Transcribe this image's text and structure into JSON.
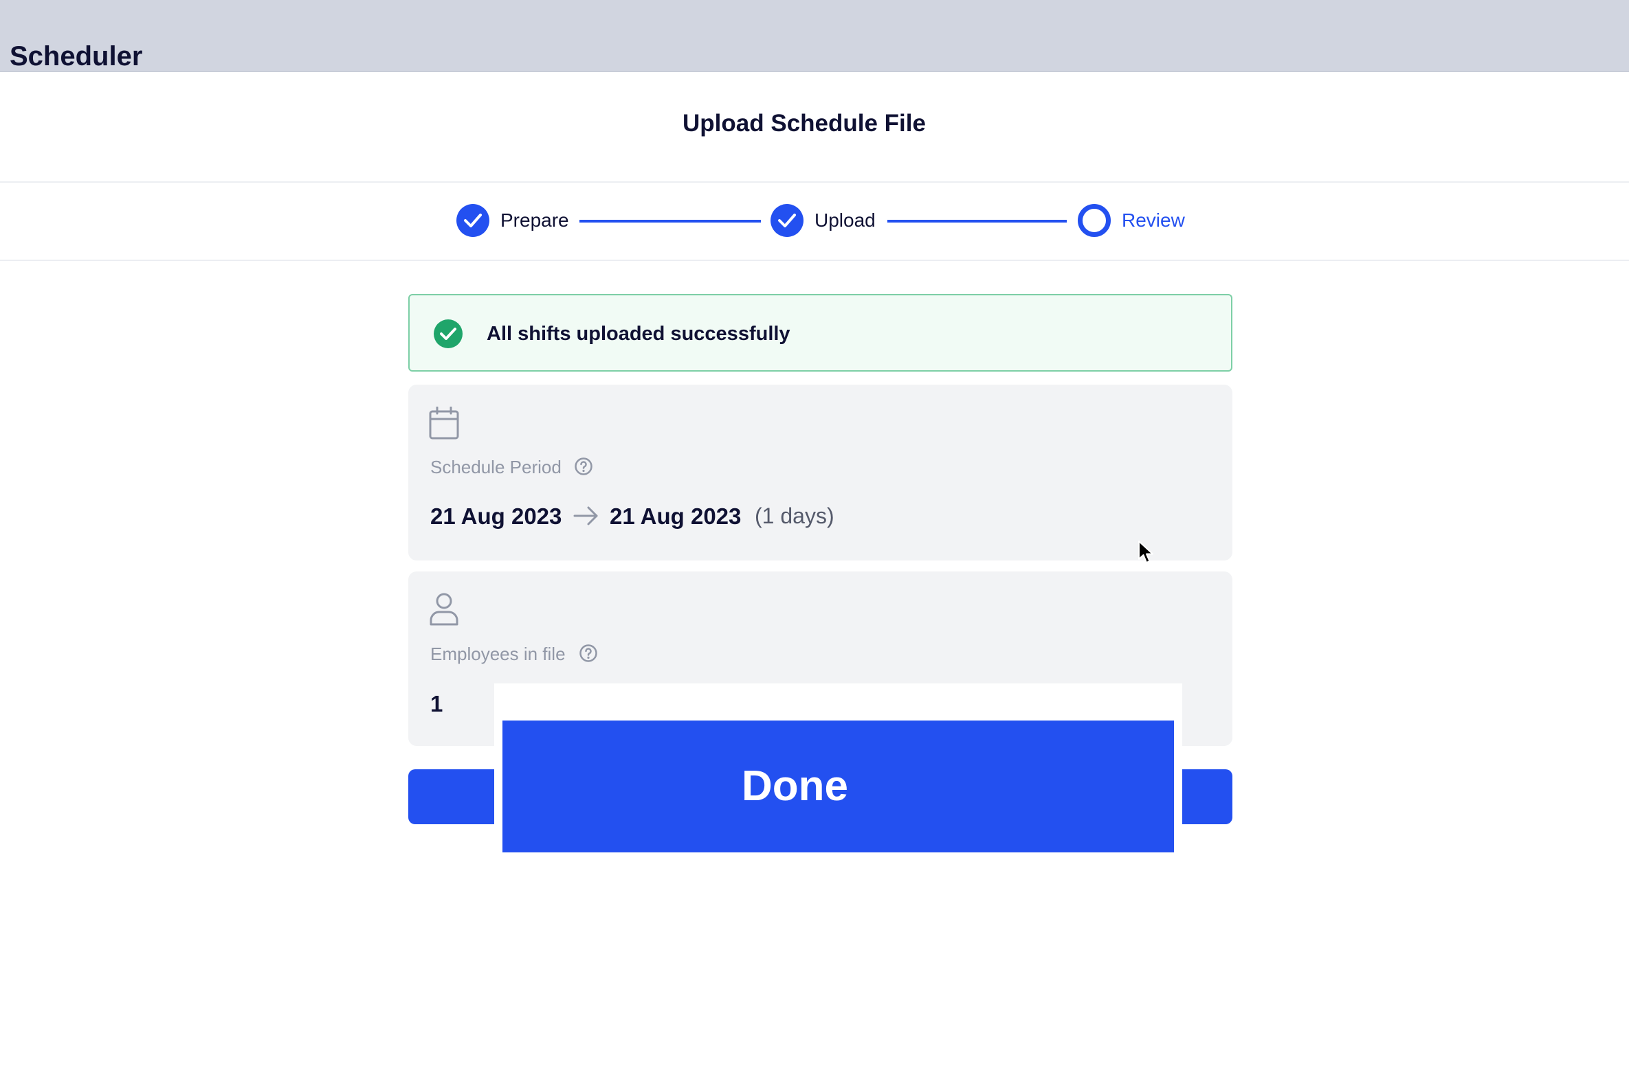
{
  "app": {
    "title": "Scheduler"
  },
  "modal": {
    "title": "Upload Schedule File"
  },
  "stepper": {
    "steps": [
      {
        "label": "Prepare",
        "state": "completed"
      },
      {
        "label": "Upload",
        "state": "completed"
      },
      {
        "label": "Review",
        "state": "current"
      }
    ]
  },
  "alert": {
    "message": "All shifts uploaded successfully",
    "icon": "check-circle-icon"
  },
  "schedule_period": {
    "label": "Schedule Period",
    "start": "21 Aug 2023",
    "end": "21 Aug 2023",
    "duration": "(1 days)",
    "icon": "calendar-icon"
  },
  "employees": {
    "label": "Employees in file",
    "count": "1",
    "icon": "user-icon"
  },
  "actions": {
    "done_label": "Done"
  },
  "colors": {
    "primary": "#2350f0",
    "success": "#1fa56a",
    "success_bg": "#f1fbf5",
    "topbar": "#d1d5e0",
    "card_bg": "#f2f3f5"
  }
}
